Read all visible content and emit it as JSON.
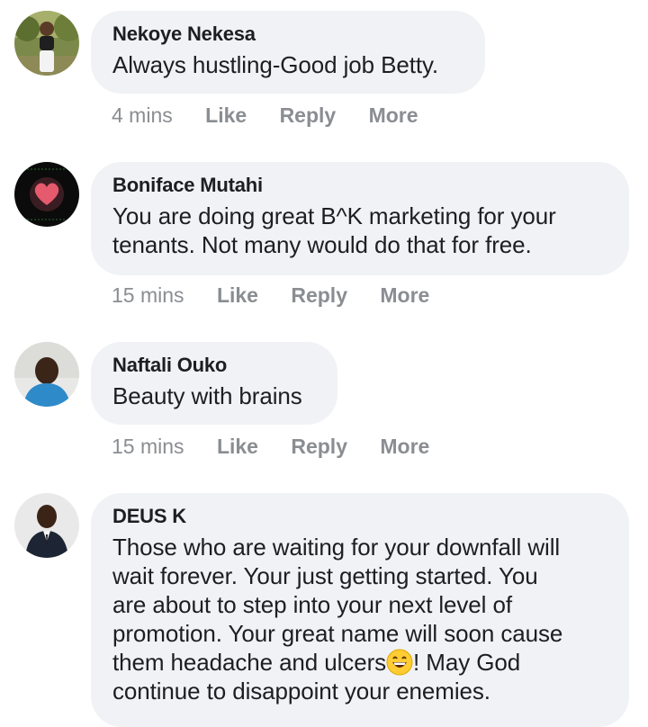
{
  "comments": [
    {
      "author": "Nekoye Nekesa",
      "lines": [
        "Always hustling-Good job Betty."
      ],
      "time": "4 mins",
      "like": "Like",
      "reply": "Reply",
      "more": "More"
    },
    {
      "author": "Boniface Mutahi",
      "lines": [
        "You are doing great B^K marketing for your",
        "tenants. Not many would do that for free."
      ],
      "time": "15 mins",
      "like": "Like",
      "reply": "Reply",
      "more": "More"
    },
    {
      "author": "Naftali Ouko",
      "lines": [
        "Beauty with brains"
      ],
      "time": "15 mins",
      "like": "Like",
      "reply": "Reply",
      "more": "More"
    },
    {
      "author": "DEUS K",
      "lines": [
        "Those who are waiting for your downfall will",
        "wait forever. Your just getting started. You",
        "are about to step into your next level of",
        "promotion. Your great name will soon cause"
      ],
      "line5_before_emoji": "them headache and ulcers",
      "line5_after_emoji": "! May God",
      "line6": "continue to disappoint your enemies."
    }
  ],
  "colors": {
    "bubble": "#f0f2f5",
    "meta": "#8a8d91",
    "text": "#1c1e21"
  },
  "icons": {
    "heart": "heart-icon",
    "emoji": "grinning-face-emoji"
  }
}
